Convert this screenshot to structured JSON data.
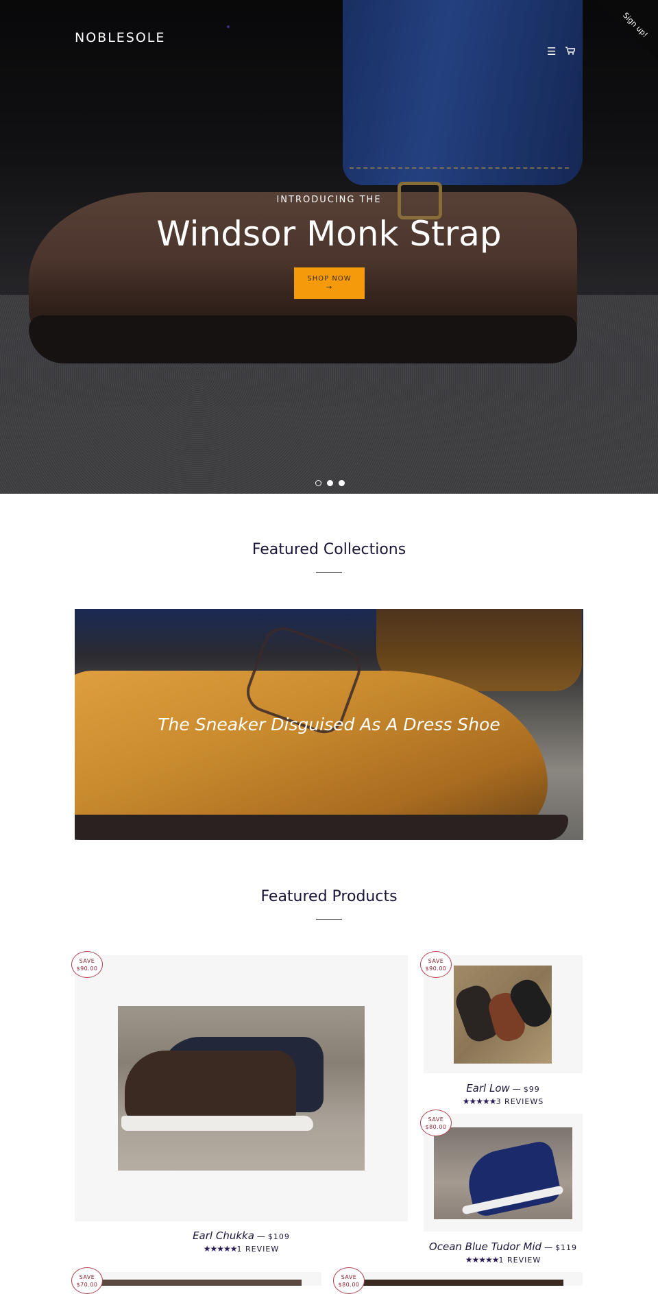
{
  "header": {
    "logo": "NOBLESOLE",
    "signup_label": "Sign up!",
    "menu_icon": "hamburger-menu-icon",
    "cart_icon": "cart-icon"
  },
  "hero": {
    "eyebrow": "INTRODUCING THE",
    "title": "Windsor Monk Strap",
    "button_label": "SHOP NOW",
    "button_arrow": "→",
    "slides": 3,
    "active_slide": 1,
    "accent_color": "#f59a0b"
  },
  "featured_collections": {
    "title": "Featured Collections",
    "items": [
      {
        "title": "The Sneaker Disguised As A Dress Shoe"
      }
    ]
  },
  "featured_products": {
    "title": "Featured Products",
    "items": [
      {
        "badge_line1": "SAVE",
        "badge_line2": "$90.00",
        "name": "Earl Chukka",
        "separator": "—",
        "price": "$109",
        "stars": "★★★★★",
        "reviews": "1 REVIEW"
      },
      {
        "badge_line1": "SAVE",
        "badge_line2": "$90.00",
        "name": "Earl Low",
        "separator": "—",
        "price": "$99",
        "stars": "★★★★★",
        "reviews": "3 REVIEWS"
      },
      {
        "badge_line1": "SAVE",
        "badge_line2": "$80.00",
        "name": "Ocean Blue Tudor Mid",
        "separator": "—",
        "price": "$119",
        "stars": "★★★★★",
        "reviews": "1 REVIEW"
      },
      {
        "badge_line1": "SAVE",
        "badge_line2": "$70.00"
      },
      {
        "badge_line1": "SAVE",
        "badge_line2": "$80.00"
      }
    ]
  }
}
